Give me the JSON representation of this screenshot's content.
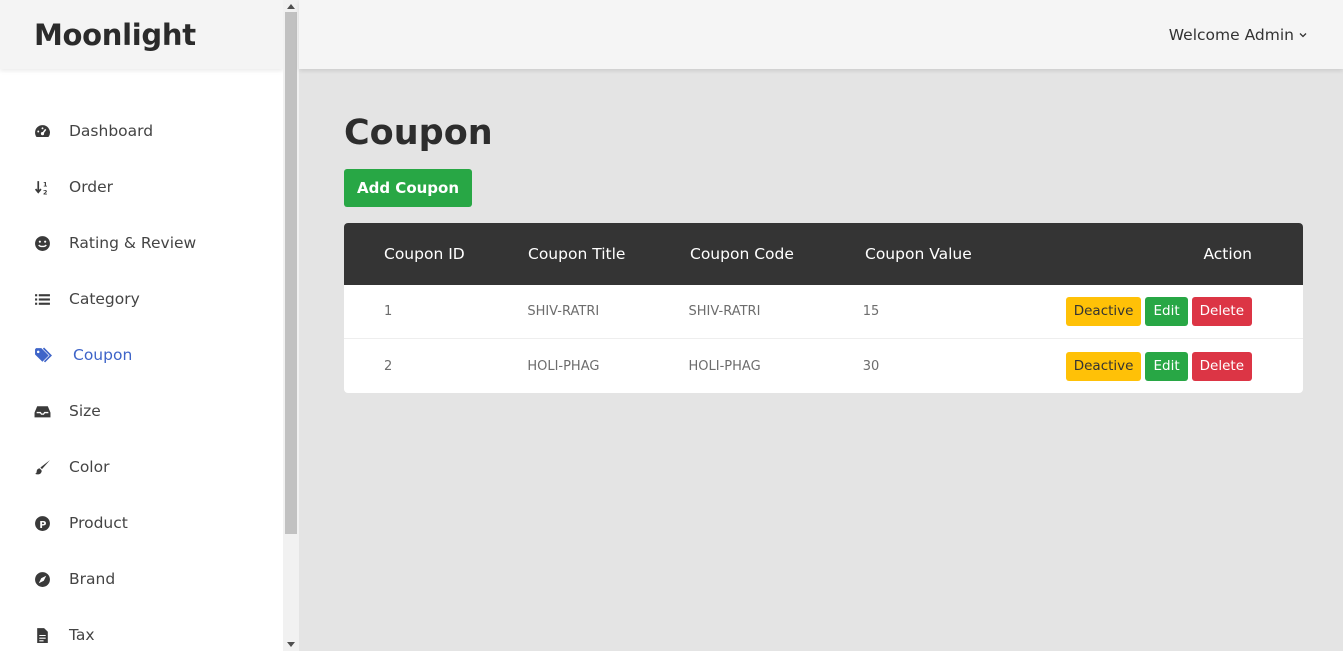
{
  "brand": "Moonlight",
  "sidebar": {
    "items": [
      {
        "label": "Dashboard",
        "icon": "dashboard-icon"
      },
      {
        "label": "Order",
        "icon": "sort-icon"
      },
      {
        "label": "Rating & Review",
        "icon": "smile-icon"
      },
      {
        "label": "Category",
        "icon": "list-icon"
      },
      {
        "label": "Coupon",
        "icon": "tags-icon",
        "active": true
      },
      {
        "label": "Size",
        "icon": "inbox-icon"
      },
      {
        "label": "Color",
        "icon": "brush-icon"
      },
      {
        "label": "Product",
        "icon": "product-icon"
      },
      {
        "label": "Brand",
        "icon": "compass-icon"
      },
      {
        "label": "Tax",
        "icon": "file-icon"
      }
    ]
  },
  "header": {
    "welcome": "Welcome Admin"
  },
  "main": {
    "title": "Coupon",
    "add_button": "Add Coupon",
    "table": {
      "headers": [
        "Coupon ID",
        "Coupon Title",
        "Coupon Code",
        "Coupon Value",
        "Action"
      ],
      "rows": [
        {
          "id": "1",
          "title": "SHIV-RATRI",
          "code": "SHIV-RATRI",
          "value": "15"
        },
        {
          "id": "2",
          "title": "HOLI-PHAG",
          "code": "HOLI-PHAG",
          "value": "30"
        }
      ],
      "actions": {
        "deactive": "Deactive",
        "edit": "Edit",
        "delete": "Delete"
      }
    }
  },
  "colors": {
    "accent": "#3e64c8",
    "success": "#28a745",
    "warning": "#ffc107",
    "danger": "#dc3545",
    "table_header": "#343434"
  }
}
